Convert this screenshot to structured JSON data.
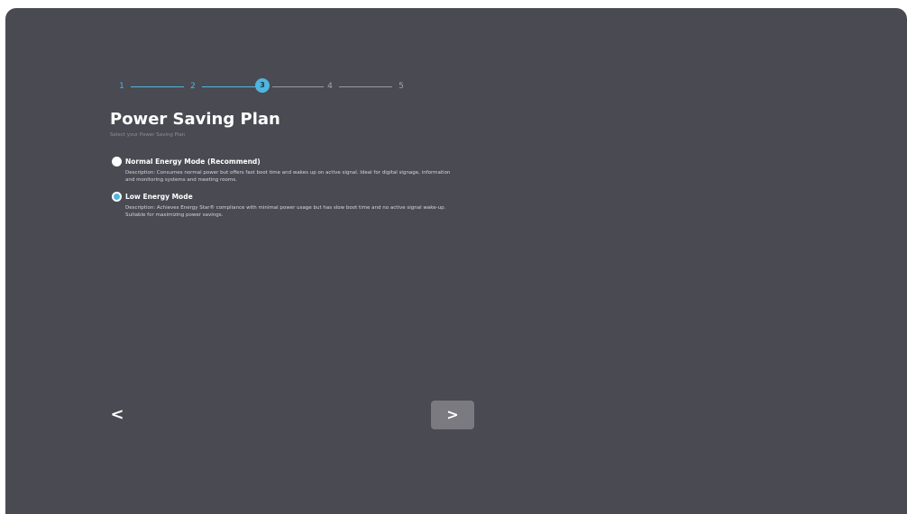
{
  "stepper": {
    "steps": [
      "1",
      "2",
      "3",
      "4",
      "5"
    ],
    "current": "3"
  },
  "page": {
    "title": "Power Saving Plan",
    "subtitle": "Select your Power Saving Plan"
  },
  "options": [
    {
      "label": "Normal Energy Mode (Recommend)",
      "description": "Description: Consumes normal power but offers fast boot time and wakes up on active signal. Ideal for digital signage, information and monitoring systems and meeting rooms.",
      "selected": false
    },
    {
      "label": "Low Energy Mode",
      "description": "Description: Achieves Energy Star® compliance with minimal power usage but has slow boot time and no active signal wake-up. Suitable for maximizing power savings.",
      "selected": true
    }
  ],
  "navigation": {
    "back_icon": "chevron-left-icon",
    "back_glyph": "<",
    "next_icon": "chevron-right-icon",
    "next_glyph": ">"
  },
  "colors": {
    "background": "#4a4a53",
    "accent": "#4fb6de",
    "next_button": "#7a7a80"
  }
}
